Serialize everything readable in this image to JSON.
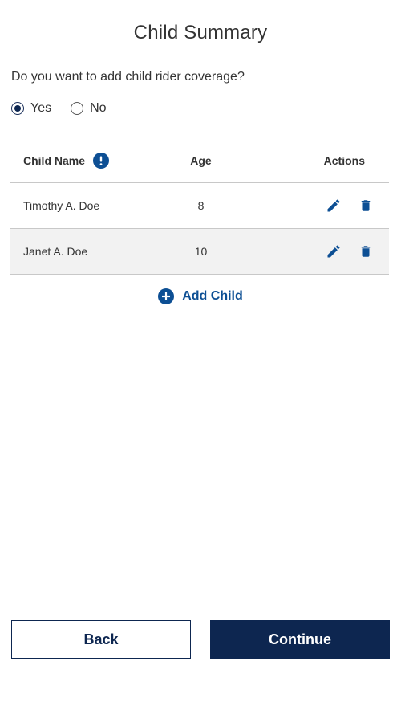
{
  "page": {
    "title": "Child Summary"
  },
  "coverage": {
    "question": "Do you want to add child rider coverage?",
    "options": [
      {
        "label": "Yes",
        "selected": true
      },
      {
        "label": "No",
        "selected": false
      }
    ]
  },
  "table": {
    "columns": {
      "name": "Child Name",
      "age": "Age",
      "actions": "Actions"
    },
    "rows": [
      {
        "name": "Timothy A. Doe",
        "age": "8"
      },
      {
        "name": "Janet A. Doe",
        "age": "10"
      }
    ]
  },
  "add_child": {
    "label": "Add Child"
  },
  "footer": {
    "back_label": "Back",
    "continue_label": "Continue"
  },
  "icons": {
    "info": "info-exclamation-icon",
    "edit": "pencil-edit-icon",
    "delete": "trash-delete-icon",
    "add": "plus-circle-icon"
  },
  "colors": {
    "primary_navy": "#0d2650",
    "accent_blue": "#0d4f94",
    "text": "#333333",
    "row_alt_bg": "#f2f2f2",
    "divider": "#c8c8c8"
  }
}
